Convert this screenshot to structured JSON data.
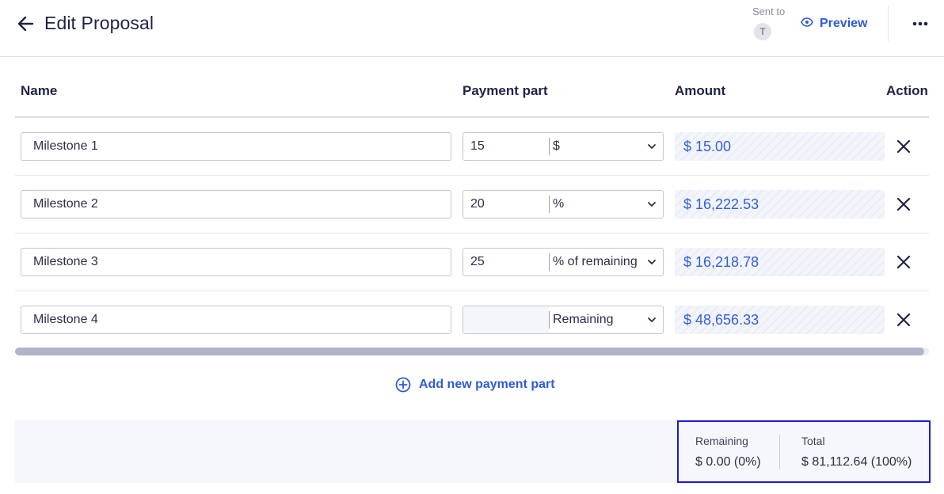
{
  "header": {
    "title": "Edit Proposal",
    "sent_to_label": "Sent to",
    "avatar_initial": "T",
    "preview_label": "Preview"
  },
  "table": {
    "columns": {
      "name": "Name",
      "payment_part": "Payment part",
      "amount": "Amount",
      "action": "Action"
    },
    "rows": [
      {
        "name": "Milestone 1",
        "payment_value": "15",
        "payment_unit": "$",
        "amount": "$ 15.00"
      },
      {
        "name": "Milestone 2",
        "payment_value": "20",
        "payment_unit": "%",
        "amount": "$ 16,222.53"
      },
      {
        "name": "Milestone 3",
        "payment_value": "25",
        "payment_unit": "% of remaining",
        "amount": "$ 16,218.78"
      },
      {
        "name": "Milestone 4",
        "payment_value": "",
        "payment_unit": "Remaining",
        "amount": "$ 48,656.33"
      }
    ]
  },
  "add_payment_part_label": "Add new payment part",
  "summary": {
    "remaining_label": "Remaining",
    "remaining_value": "$ 0.00 (0%)",
    "total_label": "Total",
    "total_value": "$ 81,112.64 (100%)"
  },
  "colors": {
    "accent": "#2f5bd8",
    "text_dark": "#1f2348",
    "highlight_border": "#1a1ad4"
  }
}
